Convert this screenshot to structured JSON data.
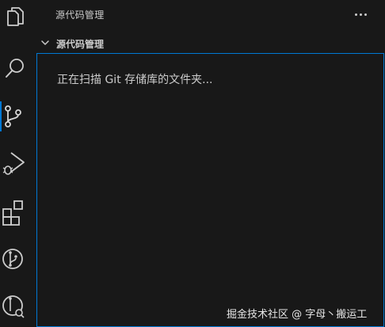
{
  "sidebar": {
    "title": "源代码管理",
    "more_icon": "ellipsis-icon"
  },
  "section": {
    "label": "源代码管理",
    "chevron_icon": "chevron-down-icon",
    "expanded": true
  },
  "panel": {
    "message": "正在扫描 Git 存储库的文件夹..."
  },
  "activity_bar": {
    "items": [
      {
        "icon": "files-icon",
        "active": false
      },
      {
        "icon": "search-icon",
        "active": false
      },
      {
        "icon": "source-control-icon",
        "active": true
      },
      {
        "icon": "run-debug-icon",
        "active": false
      },
      {
        "icon": "extensions-icon",
        "active": false
      },
      {
        "icon": "git-branch-icon",
        "active": false
      },
      {
        "icon": "git-lens-icon",
        "active": false
      }
    ]
  },
  "watermark": {
    "text": "掘金技术社区 @ 字母丶搬运工"
  },
  "colors": {
    "background": "#181818",
    "text": "#cccccc",
    "icon": "#cccccc",
    "icon_active": "#d7d7d7",
    "focus_border": "#0078d4"
  }
}
